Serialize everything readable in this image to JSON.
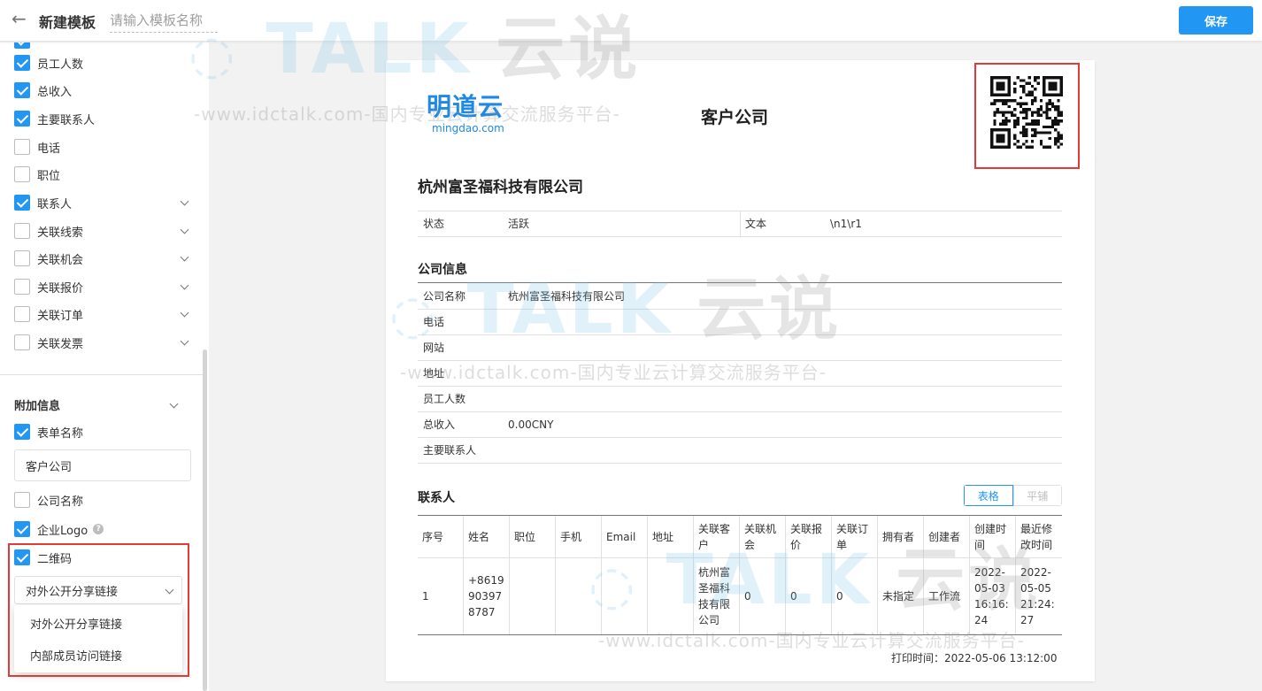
{
  "header": {
    "title": "新建模板",
    "name_placeholder": "请输入模板名称",
    "save_label": "保存"
  },
  "sidebar": {
    "fields": [
      {
        "label": "员工人数",
        "checked": true,
        "expandable": false
      },
      {
        "label": "总收入",
        "checked": true,
        "expandable": false
      },
      {
        "label": "主要联系人",
        "checked": true,
        "expandable": false
      },
      {
        "label": "电话",
        "checked": false,
        "expandable": false
      },
      {
        "label": "职位",
        "checked": false,
        "expandable": false
      },
      {
        "label": "联系人",
        "checked": true,
        "expandable": true
      },
      {
        "label": "关联线索",
        "checked": false,
        "expandable": true
      },
      {
        "label": "关联机会",
        "checked": false,
        "expandable": true
      },
      {
        "label": "关联报价",
        "checked": false,
        "expandable": true
      },
      {
        "label": "关联订单",
        "checked": false,
        "expandable": true
      },
      {
        "label": "关联发票",
        "checked": false,
        "expandable": true
      }
    ],
    "extra": {
      "title": "附加信息",
      "form_name_label": "表单名称",
      "form_name_value": "客户公司",
      "company_name_label": "公司名称",
      "logo_label": "企业Logo",
      "qrcode_label": "二维码",
      "qrcode_selected": "对外公开分享链接",
      "qrcode_options": [
        "对外公开分享链接",
        "内部成员访问链接"
      ]
    }
  },
  "preview": {
    "logo_text": "明道云",
    "logo_sub": "mingdao.com",
    "form_name": "客户公司",
    "record_title": "杭州富圣福科技有限公司",
    "status": {
      "label1": "状态",
      "value1": "活跃",
      "label2": "文本",
      "value2": "\\n1\\r1"
    },
    "company_group": {
      "title": "公司信息",
      "rows": [
        {
          "label": "公司名称",
          "value": "杭州富圣福科技有限公司"
        },
        {
          "label": "电话",
          "value": ""
        },
        {
          "label": "网站",
          "value": ""
        },
        {
          "label": "地址",
          "value": ""
        },
        {
          "label": "员工人数",
          "value": ""
        },
        {
          "label": "总收入",
          "value": "0.00CNY"
        },
        {
          "label": "主要联系人",
          "value": ""
        }
      ]
    },
    "contacts": {
      "title": "联系人",
      "view_table": "表格",
      "view_flat": "平铺",
      "headers": [
        "序号",
        "姓名",
        "职位",
        "手机",
        "Email",
        "地址",
        "关联客户",
        "关联机会",
        "关联报价",
        "关联订单",
        "拥有者",
        "创建者",
        "创建时间",
        "最近修改时间"
      ],
      "rows": [
        [
          "1",
          "+8619903978787",
          "",
          "",
          "",
          "",
          "杭州富圣福科技有限公司",
          "0",
          "0",
          "0",
          "未指定",
          "工作流",
          "2022-05-03 16:16:24",
          "2022-05-05 21:24:27"
        ]
      ]
    },
    "print_time": "打印时间：2022-05-06 13:12:00"
  },
  "watermark": {
    "brand": "TALK",
    "brand_cn": "云说",
    "url": "-www.idctalk.com-国内专业云计算交流服务平台-"
  },
  "colors": {
    "accent": "#2196f3",
    "highlight_box": "#e53935"
  }
}
